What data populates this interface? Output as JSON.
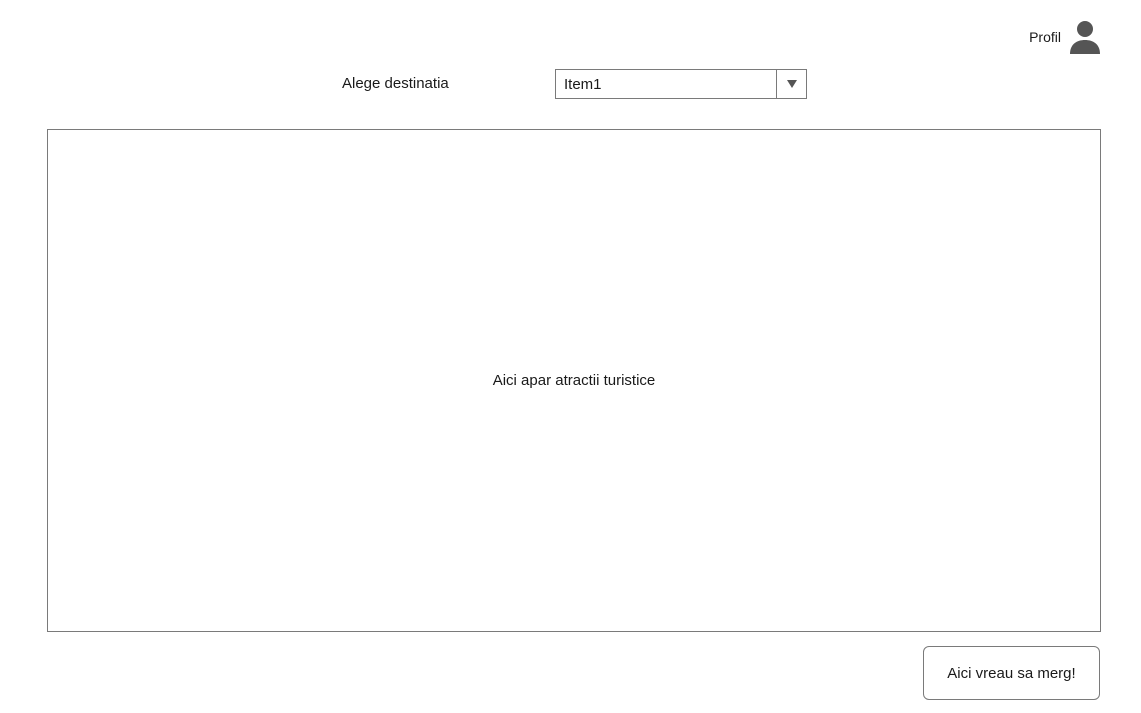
{
  "header": {
    "profile_label": "Profil",
    "profile_icon": "user-icon"
  },
  "destination": {
    "label": "Alege destinatia",
    "selected": "Item1",
    "arrow_icon": "triangle-down-icon"
  },
  "attractions": {
    "placeholder": "Aici apar atractii turistice"
  },
  "actions": {
    "go_label": "Aici vreau sa merg!"
  },
  "colors": {
    "border": "#7a7a7a",
    "icon": "#555555",
    "text": "#1a1a1a",
    "background": "#ffffff"
  }
}
